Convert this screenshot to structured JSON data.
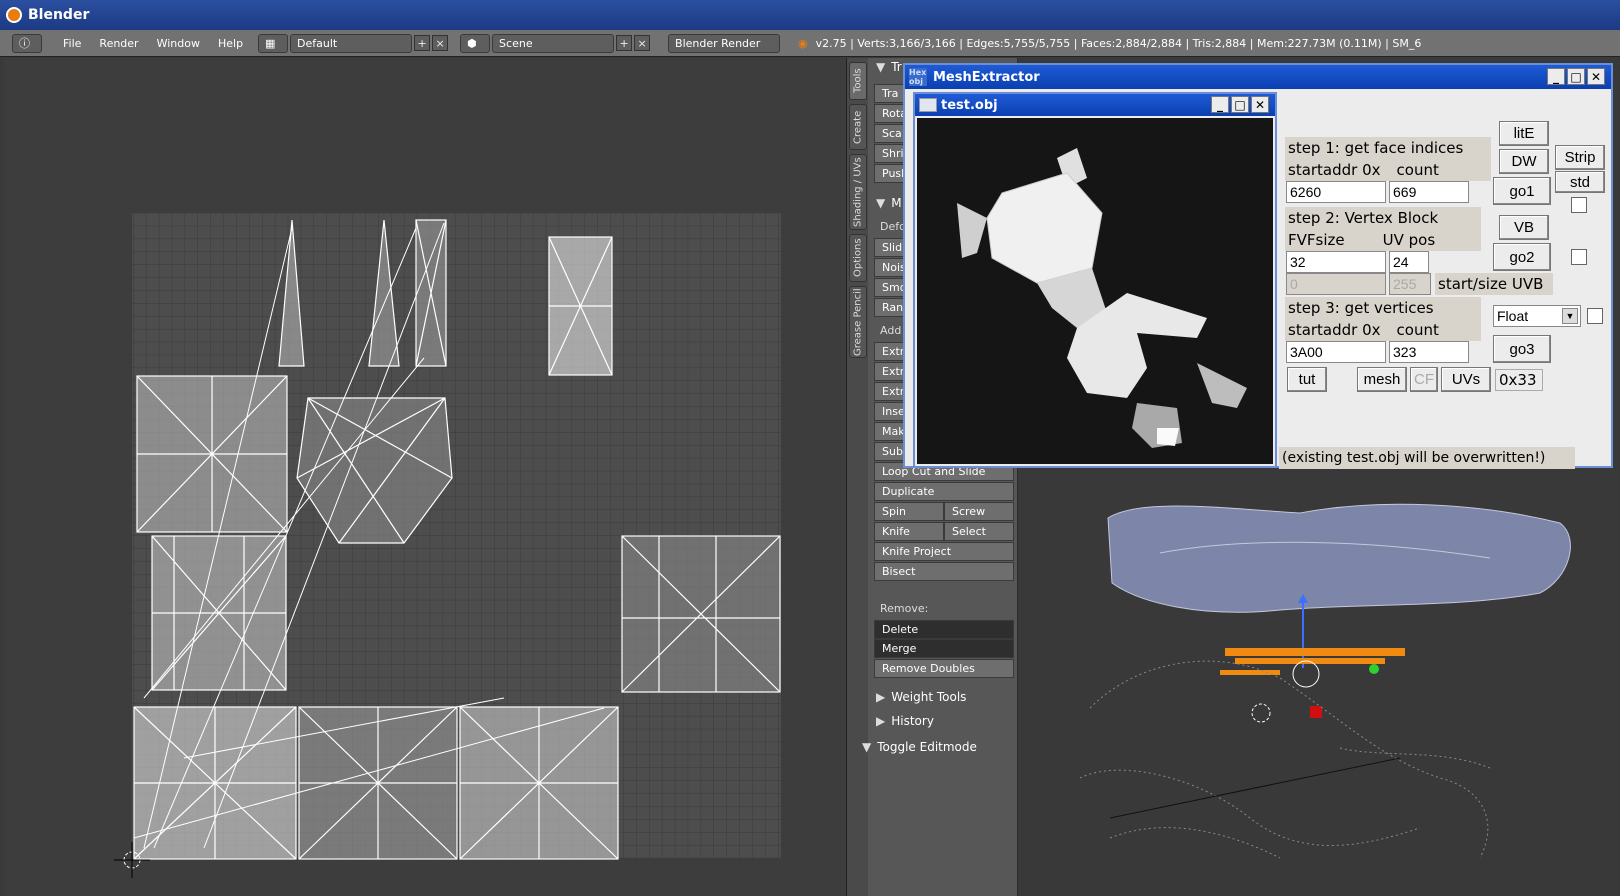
{
  "app": {
    "title": "Blender"
  },
  "menubar": {
    "items": [
      "File",
      "Render",
      "Window",
      "Help"
    ],
    "layout": "Default",
    "scene": "Scene",
    "engine": "Blender Render",
    "stats": "v2.75 | Verts:3,166/3,166 | Edges:5,755/5,755 | Faces:2,884/2,884 | Tris:2,884 | Mem:227.73M (0.11M) | SM_6"
  },
  "tabs": [
    "Tools",
    "Create",
    "Shading / UVs",
    "Options",
    "Grease Pencil"
  ],
  "toolpanel": {
    "partial": [
      "Tra",
      "Rota",
      "Sca",
      "Shri",
      "Push",
      "Defo",
      "Slid",
      "Nois",
      "Smo",
      "Ran",
      "Add",
      "Extr",
      "Extr",
      "Extr",
      "Inse",
      "Mak",
      "Sub"
    ],
    "hdr_partial": [
      "Tr",
      "M"
    ],
    "buttons": {
      "loop_cut": "Loop Cut and Slide",
      "duplicate": "Duplicate",
      "spin": "Spin",
      "screw": "Screw",
      "knife": "Knife",
      "select": "Select",
      "knife_project": "Knife Project",
      "bisect": "Bisect"
    },
    "remove_label": "Remove:",
    "delete": "Delete",
    "merge": "Merge",
    "remove_doubles": "Remove Doubles",
    "weight_tools": "Weight Tools",
    "history": "History",
    "toggle_editmode": "Toggle Editmode"
  },
  "meshextractor": {
    "title": "MeshExtractor",
    "icon_text": "Hex obj",
    "step1": "step 1: get face indices",
    "startaddr1": "startaddr 0x",
    "count1": "count",
    "addr1": "6260",
    "count1_val": "669",
    "step2": "step 2: Vertex Block",
    "fvf": "FVFsize",
    "uvpos": "UV pos",
    "fvf_val": "32",
    "uvpos_val": "24",
    "uvb_start": "0",
    "uvb_size": "255",
    "uvb_label": "start/size UVB",
    "step3": "step 3: get vertices",
    "startaddr3": "startaddr 0x",
    "count3": "count",
    "addr3": "3A00",
    "count3_val": "323",
    "float": "Float",
    "btn": {
      "lite": "litE",
      "dw": "DW",
      "strip": "Strip",
      "std": "std",
      "go1": "go1",
      "vb": "VB",
      "go2": "go2",
      "go3": "go3",
      "tut": "tut",
      "mesh": "mesh",
      "cf": "CF",
      "uvs": "UVs",
      "hex": "0x33"
    },
    "status": "(existing test.obj will be overwritten!)"
  },
  "testobj": {
    "title": "test.obj"
  },
  "colors": {
    "title_blue": "#1f5bd6",
    "blender_title": "#2b4fa0",
    "orange": "#f08a10"
  }
}
